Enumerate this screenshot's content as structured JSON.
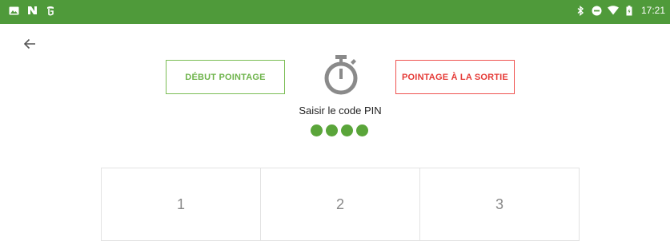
{
  "status_bar": {
    "time": "17:21",
    "left_icons": [
      "image-icon",
      "n-app-icon",
      "nyt-icon"
    ],
    "right_icons": [
      "bluetooth-icon",
      "dnd-icon",
      "wifi-icon",
      "battery-icon"
    ],
    "color": "#4f9a3a"
  },
  "header": {
    "back_icon": "arrow-left-icon"
  },
  "modes": {
    "start_label": "DÉBUT POINTAGE",
    "end_label": "POINTAGE À LA SORTIE",
    "start_color": "#6db34a",
    "end_color": "#e53935"
  },
  "pin": {
    "label": "Saisir le code PIN",
    "entered_digits": 4,
    "dot_color": "#5aa53a",
    "icon": "stopwatch-icon"
  },
  "keypad": {
    "keys": [
      "1",
      "2",
      "3"
    ]
  }
}
